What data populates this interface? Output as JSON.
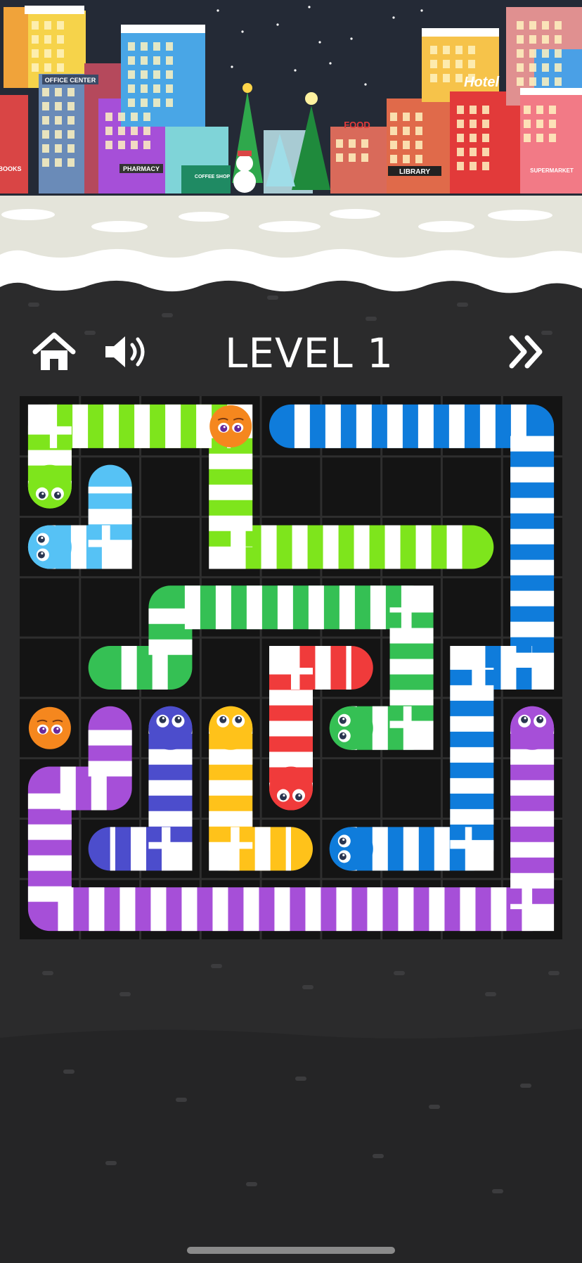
{
  "hud": {
    "level_title": "LEVEL 1",
    "home_icon": "home-icon",
    "sound_icon": "speaker-icon",
    "skip_icon": "double-chevron-right-icon"
  },
  "city": {
    "signs": [
      "OFFICE CENTER",
      "PHARMACY",
      "COFFEE SHOP",
      "FOOD",
      "LIBRARY",
      "Hotel",
      "SUPERMARKET",
      "BOOKS"
    ]
  },
  "board": {
    "cols": 9,
    "rows": 9,
    "stripe_color": "#ffffff",
    "snakes": [
      {
        "name": "lime",
        "color": "#7ee51c",
        "head": [
          0,
          1
        ],
        "path": [
          [
            0,
            1
          ],
          [
            0,
            0
          ],
          [
            1,
            0
          ],
          [
            2,
            0
          ],
          [
            3,
            0
          ],
          [
            3,
            1
          ],
          [
            3,
            2
          ],
          [
            4,
            2
          ],
          [
            5,
            2
          ],
          [
            6,
            2
          ],
          [
            7,
            2
          ]
        ]
      },
      {
        "name": "light-blue",
        "color": "#56c2f5",
        "head": [
          0,
          2
        ],
        "path": [
          [
            0,
            2
          ],
          [
            1,
            2
          ],
          [
            1,
            1
          ]
        ]
      },
      {
        "name": "blue",
        "color": "#0f7cdb",
        "head": [
          5,
          7
        ],
        "path": [
          [
            5,
            7
          ],
          [
            6,
            7
          ],
          [
            7,
            7
          ],
          [
            7,
            6
          ],
          [
            7,
            5
          ],
          [
            7,
            4
          ],
          [
            8,
            4
          ],
          [
            8,
            3
          ],
          [
            8,
            2
          ],
          [
            8,
            1
          ],
          [
            8,
            0
          ],
          [
            7,
            0
          ],
          [
            6,
            0
          ],
          [
            5,
            0
          ],
          [
            4,
            0
          ]
        ]
      },
      {
        "name": "green",
        "color": "#35c054",
        "head": [
          5,
          5
        ],
        "path": [
          [
            5,
            5
          ],
          [
            6,
            5
          ],
          [
            6,
            4
          ],
          [
            6,
            3
          ],
          [
            5,
            3
          ],
          [
            4,
            3
          ],
          [
            3,
            3
          ],
          [
            2,
            3
          ],
          [
            2,
            4
          ],
          [
            1,
            4
          ]
        ]
      },
      {
        "name": "red",
        "color": "#f03b3b",
        "head": [
          4,
          6
        ],
        "path": [
          [
            4,
            6
          ],
          [
            4,
            5
          ],
          [
            4,
            4
          ],
          [
            5,
            4
          ]
        ]
      },
      {
        "name": "indigo",
        "color": "#4c4dcc",
        "head": [
          2,
          5
        ],
        "path": [
          [
            2,
            5
          ],
          [
            2,
            6
          ],
          [
            2,
            7
          ],
          [
            1,
            7
          ]
        ]
      },
      {
        "name": "yellow",
        "color": "#ffc21a",
        "head": [
          3,
          5
        ],
        "path": [
          [
            3,
            5
          ],
          [
            3,
            6
          ],
          [
            3,
            7
          ],
          [
            4,
            7
          ]
        ]
      },
      {
        "name": "purple",
        "color": "#a64fd8",
        "head": [
          8,
          5
        ],
        "path": [
          [
            8,
            5
          ],
          [
            8,
            6
          ],
          [
            8,
            7
          ],
          [
            8,
            8
          ],
          [
            7,
            8
          ],
          [
            6,
            8
          ],
          [
            5,
            8
          ],
          [
            4,
            8
          ],
          [
            3,
            8
          ],
          [
            2,
            8
          ],
          [
            1,
            8
          ],
          [
            0,
            8
          ],
          [
            0,
            7
          ],
          [
            0,
            6
          ],
          [
            1,
            6
          ],
          [
            1,
            5
          ]
        ]
      }
    ],
    "blobs": [
      {
        "name": "orange-blob-top",
        "color": "#f5871e",
        "cell": [
          3,
          0
        ]
      },
      {
        "name": "orange-blob-left",
        "color": "#f5871e",
        "cell": [
          0,
          5
        ]
      }
    ]
  }
}
